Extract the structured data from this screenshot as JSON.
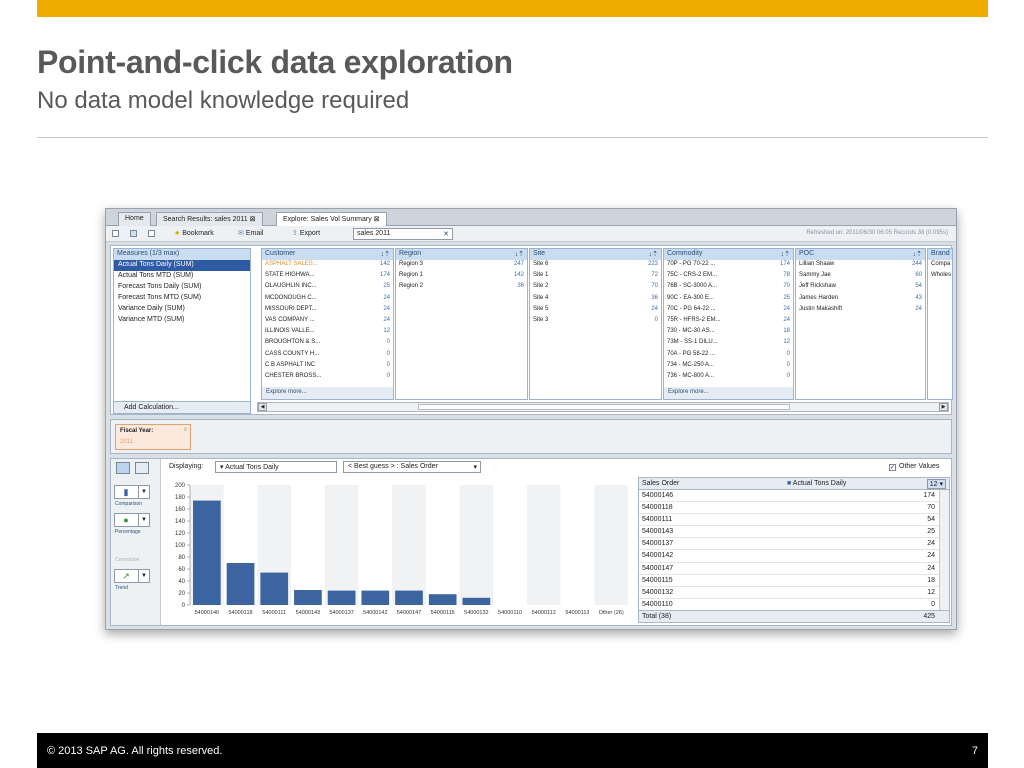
{
  "slide": {
    "title": "Point-and-click data exploration",
    "subtitle": "No data model knowledge required",
    "copyright": "2013 SAP AG. All rights reserved.",
    "copyright_symbol": "©",
    "page_number": "7",
    "accent_color": "#f0ab00"
  },
  "app": {
    "tabs": [
      {
        "label": "Home"
      },
      {
        "label": "Search Results: sales 2011"
      },
      {
        "label": "Explore: Sales Vol Summary"
      }
    ],
    "toolbar": {
      "bookmark": "Bookmark",
      "email": "Email",
      "export": "Export",
      "search_value": "sales 2011",
      "refreshed": "Refreshed on: 2011/06/30 06:05 Records 38 (0.095s)"
    },
    "measures": {
      "header": "Measures (1/3 max)",
      "items": [
        "Actual Tons Daily (SUM)",
        "Actual Tons MTD (SUM)",
        "Forecast Tons Daily (SUM)",
        "Forecast Tons MTD (SUM)",
        "Variance Daily (SUM)",
        "Variance MTD (SUM)"
      ],
      "add_calc": "Add Calculation..."
    },
    "facets": [
      {
        "name": "Customer",
        "explore": "Explore more...",
        "rows": [
          {
            "label": "ASPHALT SALES...",
            "value": "142"
          },
          {
            "label": "STATE HIGHWA...",
            "value": "174"
          },
          {
            "label": "OLAUGHLIN INC...",
            "value": "25"
          },
          {
            "label": "MCDONOUGH C...",
            "value": "24"
          },
          {
            "label": "MISSOURI DEPT...",
            "value": "24"
          },
          {
            "label": "VAS COMPANY ...",
            "value": "24"
          },
          {
            "label": "ILLINOIS VALLE...",
            "value": "12"
          },
          {
            "label": "BROUGHTON & S...",
            "value": "0"
          },
          {
            "label": "CASS COUNTY H...",
            "value": "0"
          },
          {
            "label": "C B ASPHALT INC",
            "value": "0"
          },
          {
            "label": "CHESTER BROSS...",
            "value": "0"
          }
        ]
      },
      {
        "name": "Region",
        "explore": "",
        "rows": [
          {
            "label": "Region 3",
            "value": "247"
          },
          {
            "label": "Region 1",
            "value": "142"
          },
          {
            "label": "Region 2",
            "value": "36"
          }
        ]
      },
      {
        "name": "Site",
        "explore": "",
        "rows": [
          {
            "label": "Site 6",
            "value": "223"
          },
          {
            "label": "Site 1",
            "value": "72"
          },
          {
            "label": "Site 2",
            "value": "70"
          },
          {
            "label": "Site 4",
            "value": "36"
          },
          {
            "label": "Site 5",
            "value": "24"
          },
          {
            "label": "Site 3",
            "value": "0"
          }
        ]
      },
      {
        "name": "Commodity",
        "explore": "Explore more...",
        "rows": [
          {
            "label": "70P - PG 70-22 ...",
            "value": "174"
          },
          {
            "label": "75C - CRS-2 EM...",
            "value": "78"
          },
          {
            "label": "76B - SC-3000 A...",
            "value": "70"
          },
          {
            "label": "90C - EA-300 E...",
            "value": "25"
          },
          {
            "label": "70C - PG 64-22 ...",
            "value": "24"
          },
          {
            "label": "75R - HFRS-2 EM...",
            "value": "24"
          },
          {
            "label": "730 - MC-30 AS...",
            "value": "18"
          },
          {
            "label": "73M - SS-1 DILU...",
            "value": "12"
          },
          {
            "label": "70A - PG 58-22 ...",
            "value": "0"
          },
          {
            "label": "734 - MC-250 A...",
            "value": "0"
          },
          {
            "label": "736 - MC-800 A...",
            "value": "0"
          }
        ]
      },
      {
        "name": "POC",
        "explore": "",
        "rows": [
          {
            "label": "Lillian Shaaw",
            "value": "244"
          },
          {
            "label": "Sammy Jae",
            "value": "60"
          },
          {
            "label": "Jeff Rickshaw",
            "value": "54"
          },
          {
            "label": "James Harden",
            "value": "43"
          },
          {
            "label": "Justin Makashift",
            "value": "24"
          }
        ]
      },
      {
        "name": "Brand",
        "explore": "",
        "rows": [
          {
            "label": "Compa",
            "value": ""
          },
          {
            "label": "Wholes",
            "value": ""
          }
        ]
      }
    ],
    "filter": {
      "label": "Fiscal Year:",
      "value": "2011",
      "close": "x"
    },
    "side_labels": {
      "comparison": "Comparison",
      "percentage": "Percentage",
      "correlation": "Correlation",
      "trend": "Trend"
    },
    "displaying": {
      "label": "Displaying:",
      "measure": "Actual Tons Daily",
      "guess": "< Best guess > : Sales Order"
    },
    "other_values": "Other Values",
    "table": {
      "col1": "Sales Order",
      "col2": "Actual Tons Daily",
      "sort_badge": "12",
      "rows": [
        [
          "54000146",
          "174"
        ],
        [
          "54000118",
          "70"
        ],
        [
          "54000111",
          "54"
        ],
        [
          "54000143",
          "25"
        ],
        [
          "54000137",
          "24"
        ],
        [
          "54000142",
          "24"
        ],
        [
          "54000147",
          "24"
        ],
        [
          "54000115",
          "18"
        ],
        [
          "54000132",
          "12"
        ],
        [
          "54000110",
          "0"
        ]
      ],
      "total_label": "Total (38)",
      "total_value": "425"
    }
  },
  "chart_data": {
    "type": "bar",
    "categories": [
      "54000146",
      "54000118",
      "54000111",
      "54000143",
      "54000137",
      "54000142",
      "54000147",
      "54000115",
      "54000132",
      "54000110",
      "54000112",
      "54000113",
      "Other (26)"
    ],
    "values": [
      174,
      70,
      54,
      25,
      24,
      24,
      24,
      18,
      12,
      0,
      0,
      0,
      0
    ],
    "ylim": [
      0,
      200
    ],
    "yticks": [
      0,
      20,
      40,
      60,
      80,
      100,
      120,
      140,
      160,
      180,
      200
    ],
    "bar_color": "#3b64a0",
    "grid": true
  }
}
